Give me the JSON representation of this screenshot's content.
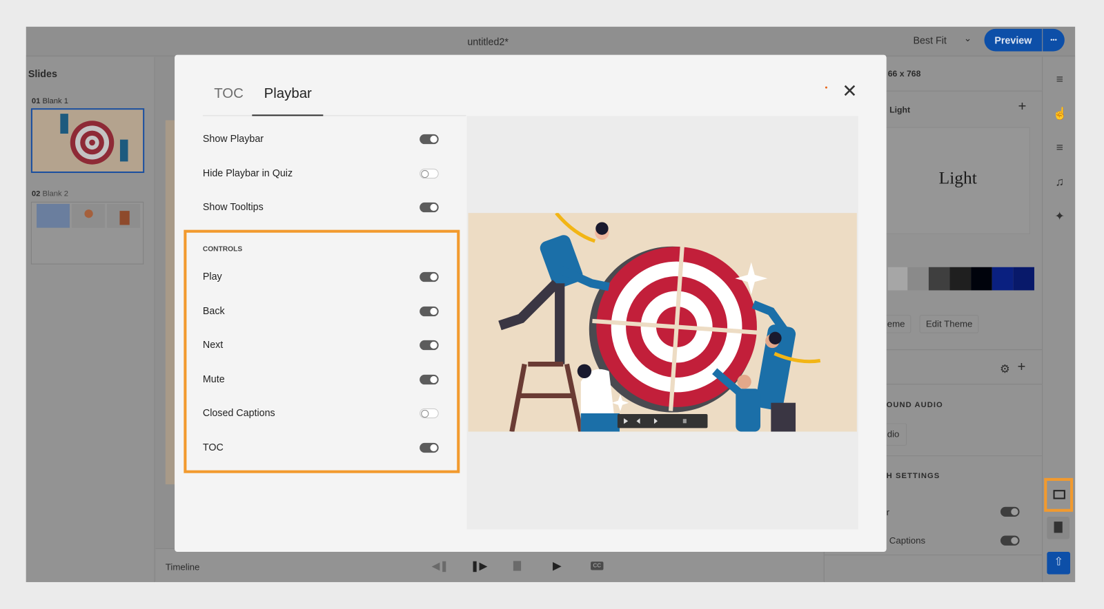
{
  "app": {
    "title": "untitled2*",
    "zoom_select": "Best Fit",
    "preview_label": "Preview",
    "more_label": "•••",
    "colors": {
      "accent": "#0d4fa8",
      "highlight": "#f29a2e"
    }
  },
  "slides_panel": {
    "heading": "Slides",
    "slides": [
      {
        "number": "01",
        "name": "Blank 1"
      },
      {
        "number": "02",
        "name": "Blank 2"
      }
    ]
  },
  "timeline": {
    "label": "Timeline",
    "cc": "CC"
  },
  "right_panel": {
    "size": "66 x 768",
    "theme_label": ": Light",
    "theme_preview": "Light",
    "theme_button": "eme",
    "edit_theme": "Edit Theme",
    "audio_heading": "OUND AUDIO",
    "audio_button": "dio",
    "settings_heading": "H SETTINGS",
    "setting_1": "r",
    "setting_2": "Captions",
    "palette": [
      "#a6a6a6",
      "#8a8a8a",
      "#3f3f3f",
      "#1f1f1f",
      "#00030c",
      "#0a2080",
      "#08196a"
    ]
  },
  "modal": {
    "tabs": [
      {
        "label": "TOC",
        "active": false
      },
      {
        "label": "Playbar",
        "active": true
      }
    ],
    "rows": [
      {
        "label": "Show Playbar",
        "on": true
      },
      {
        "label": "Hide Playbar in Quiz",
        "on": false
      },
      {
        "label": "Show Tooltips",
        "on": true
      }
    ],
    "controls_heading": "CONTROLS",
    "controls": [
      {
        "label": "Play",
        "on": true
      },
      {
        "label": "Back",
        "on": true
      },
      {
        "label": "Next",
        "on": true
      },
      {
        "label": "Mute",
        "on": true
      },
      {
        "label": "Closed Captions",
        "on": false
      },
      {
        "label": "TOC",
        "on": true
      }
    ]
  }
}
